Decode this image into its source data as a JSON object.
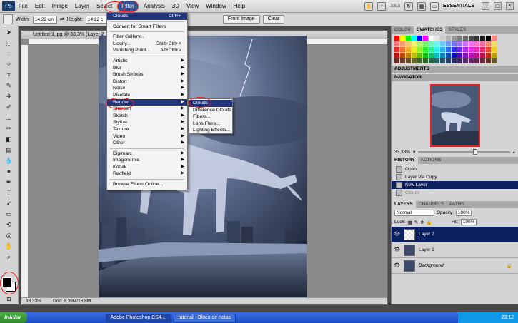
{
  "menubar": {
    "logo": "Ps",
    "items": [
      "File",
      "Edit",
      "Image",
      "Layer",
      "Select",
      "Filter",
      "Analysis",
      "3D",
      "View",
      "Window",
      "Help"
    ],
    "zoom": "33,3",
    "workspace": "ESSENTIALS"
  },
  "options": {
    "width_label": "Width:",
    "width_value": "14,22 cm",
    "height_label": "Height:",
    "height_value": "14,22 c",
    "front_image": "Front Image",
    "clear": "Clear"
  },
  "document": {
    "title": "Untitled-1.jpg @ 33,3% (Layer 2",
    "zoom_status": "33,33%",
    "doc_status": "Doc: 8,39M/16,8M"
  },
  "filter_menu": {
    "items": [
      {
        "label": "Clouds",
        "shortcut": "Ctrl+F",
        "sel": true
      },
      {
        "sep": true
      },
      {
        "label": "Convert for Smart Filters"
      },
      {
        "sep": true
      },
      {
        "label": "Filter Gallery..."
      },
      {
        "label": "Liquify...",
        "shortcut": "Shift+Ctrl+X"
      },
      {
        "label": "Vanishing Point...",
        "shortcut": "Alt+Ctrl+V"
      },
      {
        "sep": true
      },
      {
        "label": "Artistic",
        "sub": true
      },
      {
        "label": "Blur",
        "sub": true
      },
      {
        "label": "Brush Strokes",
        "sub": true
      },
      {
        "label": "Distort",
        "sub": true
      },
      {
        "label": "Noise",
        "sub": true
      },
      {
        "label": "Pixelate",
        "sub": true
      },
      {
        "label": "Render",
        "sub": true,
        "sel": true
      },
      {
        "label": "Sharpen",
        "sub": true
      },
      {
        "label": "Sketch",
        "sub": true
      },
      {
        "label": "Stylize",
        "sub": true
      },
      {
        "label": "Texture",
        "sub": true
      },
      {
        "label": "Video",
        "sub": true
      },
      {
        "label": "Other",
        "sub": true
      },
      {
        "sep": true
      },
      {
        "label": "Digimarc",
        "sub": true
      },
      {
        "label": "Imagenomic",
        "sub": true
      },
      {
        "label": "Kodak",
        "sub": true
      },
      {
        "label": "Redfield",
        "sub": true
      },
      {
        "sep": true
      },
      {
        "label": "Browse Filters Online..."
      }
    ],
    "render_sub": [
      "Clouds",
      "Difference Clouds",
      "Fibers...",
      "Lens Flare...",
      "Lighting Effects..."
    ]
  },
  "panels": {
    "swatch_tabs": [
      "COLOR",
      "SWATCHES",
      "STYLES"
    ],
    "adjustments": "ADJUSTMENTS",
    "navigator": "NAVIGATOR",
    "nav_zoom": "33,33%",
    "history_tabs": [
      "HISTORY",
      "ACTIONS"
    ],
    "history": [
      {
        "label": "Open"
      },
      {
        "label": "Layer Via Copy"
      },
      {
        "label": "New Layer",
        "sel": true
      },
      {
        "label": "Clouds",
        "dim": true
      }
    ],
    "layers_tabs": [
      "LAYERS",
      "CHANNELS",
      "PATHS"
    ],
    "blend_mode": "Normal",
    "opacity_label": "Opacity:",
    "opacity": "100%",
    "lock_label": "Lock:",
    "fill_label": "Fill:",
    "fill": "100%",
    "layers": [
      {
        "name": "Layer 2",
        "sel": true
      },
      {
        "name": "Layer 1"
      },
      {
        "name": "Background",
        "italic": true
      }
    ]
  },
  "taskbar": {
    "start": "Iniciar",
    "tasks": [
      "Adobe Photoshop CS4...",
      "tutorial - Bloco de notas"
    ],
    "clock": "23:12"
  },
  "colors": {
    "menu_highlight": "#23357a",
    "annotation_red": "#e02020"
  }
}
